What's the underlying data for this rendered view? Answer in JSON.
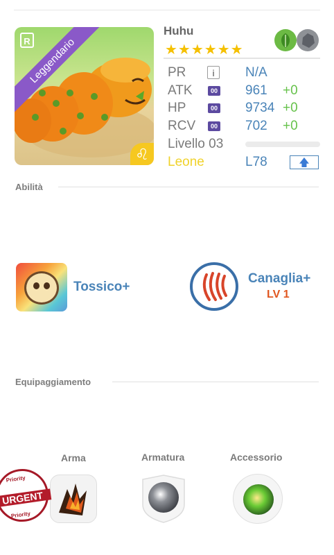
{
  "card": {
    "rarity_icon": "R",
    "rarity_label": "Leggendario",
    "zodiac_symbol": "♌",
    "name": "Huhu",
    "stars": "★★★★★★",
    "elements": [
      "leaf-icon",
      "rock-icon"
    ]
  },
  "stats": {
    "pr": {
      "label": "PR",
      "info": "i",
      "value": "N/A"
    },
    "atk": {
      "label": "ATK",
      "tag": "00",
      "value": "961",
      "bonus": "+0"
    },
    "hp": {
      "label": "HP",
      "tag": "00",
      "value": "9734",
      "bonus": "+0"
    },
    "rcv": {
      "label": "RCV",
      "tag": "00",
      "value": "702",
      "bonus": "+0"
    },
    "level": {
      "label": "Livello 03",
      "progress": 0
    },
    "zodiac": {
      "name": "Leone",
      "value": "L78",
      "upgrade_icon": "🡅"
    }
  },
  "abilities": {
    "title": "Abilità",
    "items": [
      {
        "name": "Tossico+",
        "icon": "skull-icon"
      },
      {
        "name": "Canaglia+",
        "level": "LV 1",
        "icon": "claw-scratch-icon"
      }
    ]
  },
  "equipment": {
    "title": "Equipaggiamento",
    "slots": [
      {
        "label": "Arma",
        "icon": "claw-weapon-icon"
      },
      {
        "label": "Armatura",
        "icon": "armor-gem-icon"
      },
      {
        "label": "Accessorio",
        "icon": "green-orb-icon"
      }
    ],
    "stamp": {
      "top": "Priority",
      "main": "URGENT",
      "bottom": "Priority"
    }
  },
  "colors": {
    "accent_blue": "#4a84b8",
    "bonus_green": "#66c24b",
    "legendary_purple": "#8a59c8",
    "zodiac_yellow": "#f0d22a",
    "level_orange": "#e0561f",
    "stamp_red": "#a51927"
  }
}
